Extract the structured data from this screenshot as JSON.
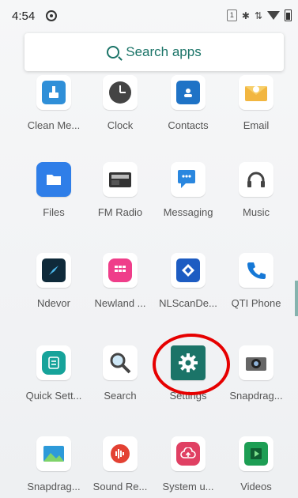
{
  "status": {
    "time": "4:54",
    "sim": "1"
  },
  "search": {
    "label": "Search apps"
  },
  "apps": [
    {
      "label": "Clean Me...",
      "icon": "broom-icon",
      "color": "#2f8fd8"
    },
    {
      "label": "Clock",
      "icon": "clock-icon",
      "color": "#444444"
    },
    {
      "label": "Contacts",
      "icon": "contact-card-icon",
      "color": "#1f73c6"
    },
    {
      "label": "Email",
      "icon": "envelope-icon",
      "color": "#f2b640"
    },
    {
      "label": "Files",
      "icon": "folder-icon",
      "color": "#2f7ee8"
    },
    {
      "label": "FM Radio",
      "icon": "radio-icon",
      "color": "#333333"
    },
    {
      "label": "Messaging",
      "icon": "chat-bubble-icon",
      "color": "#2a87df"
    },
    {
      "label": "Music",
      "icon": "headphones-icon",
      "color": "#444444"
    },
    {
      "label": "Ndevor",
      "icon": "compass-icon",
      "color": "#0f2a3a"
    },
    {
      "label": "Newland ...",
      "icon": "grid-app-icon",
      "color": "#ef3e8a"
    },
    {
      "label": "NLScanDe...",
      "icon": "scan-diamond-icon",
      "color": "#1d5cc2"
    },
    {
      "label": "QTI Phone",
      "icon": "phone-icon",
      "color": "#1678d6"
    },
    {
      "label": "Quick Sett...",
      "icon": "quick-settings-icon",
      "color": "#16a39a"
    },
    {
      "label": "Search",
      "icon": "magnifier-icon",
      "color": "#444444"
    },
    {
      "label": "Settings",
      "icon": "gear-icon",
      "color": "#1b7468"
    },
    {
      "label": "Snapdrag...",
      "icon": "camera-icon",
      "color": "#555555"
    },
    {
      "label": "Snapdrag...",
      "icon": "gallery-icon",
      "color": "#2d9ad9"
    },
    {
      "label": "Sound Re...",
      "icon": "sound-recorder-icon",
      "color": "#e34133"
    },
    {
      "label": "System u...",
      "icon": "cloud-update-icon",
      "color": "#e04063"
    },
    {
      "label": "Videos",
      "icon": "play-icon",
      "color": "#1d9e54"
    }
  ],
  "annotation": {
    "color": "#e60000",
    "target": "Settings"
  }
}
